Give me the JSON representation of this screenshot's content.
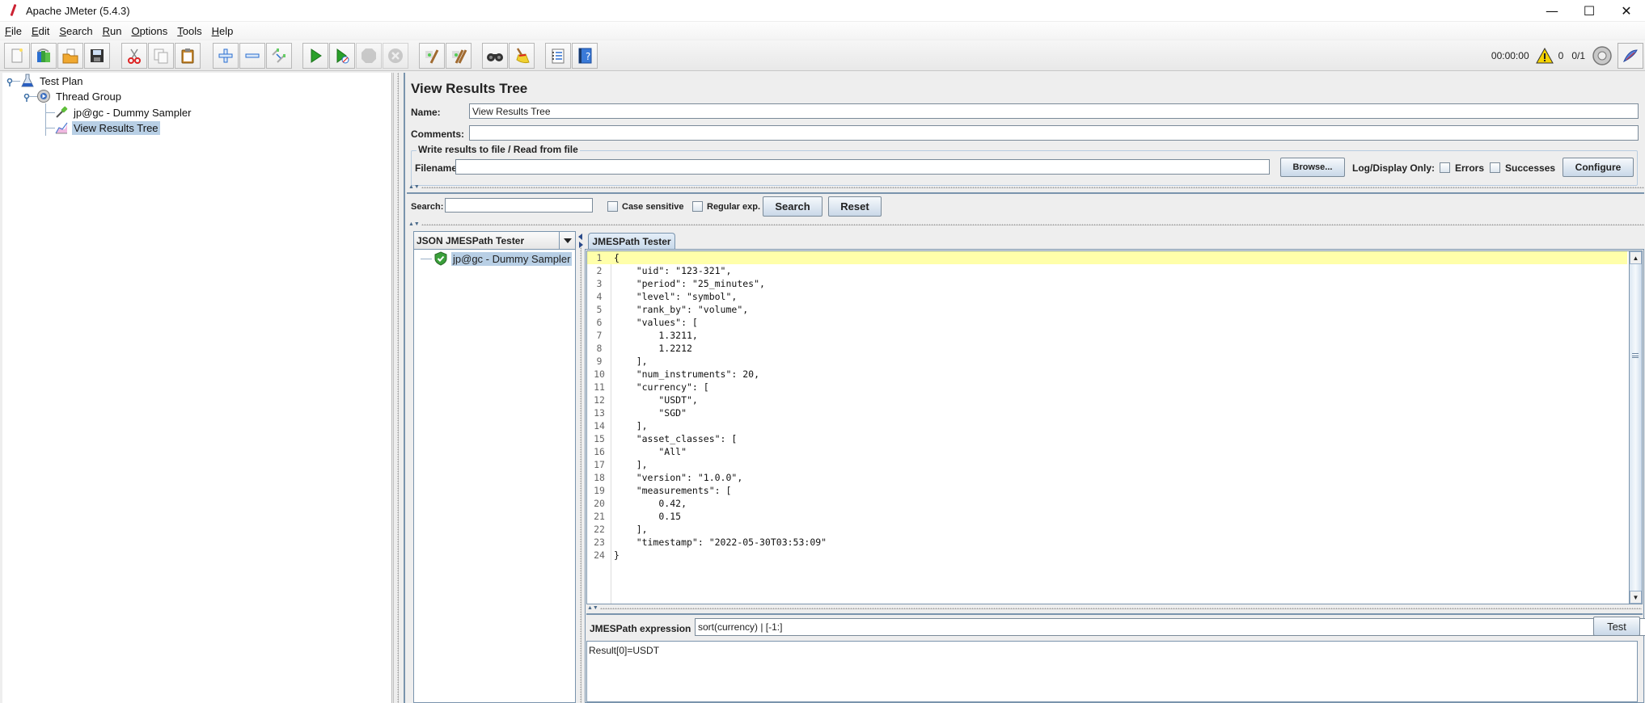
{
  "window": {
    "title": "Apache JMeter (5.4.3)",
    "controls": {
      "minimize": "—",
      "maximize": "☐",
      "close": "✕"
    }
  },
  "menu": [
    {
      "label": "File",
      "mnemonic": "F",
      "rest": "ile"
    },
    {
      "label": "Edit",
      "mnemonic": "E",
      "rest": "dit"
    },
    {
      "label": "Search",
      "mnemonic": "S",
      "rest": "earch"
    },
    {
      "label": "Run",
      "mnemonic": "R",
      "rest": "un"
    },
    {
      "label": "Options",
      "mnemonic": "O",
      "rest": "ptions"
    },
    {
      "label": "Tools",
      "mnemonic": "T",
      "rest": "ools"
    },
    {
      "label": "Help",
      "mnemonic": "H",
      "rest": "elp"
    }
  ],
  "toolbar": {
    "buttons": [
      {
        "name": "new-icon",
        "enabled": true
      },
      {
        "name": "templates-icon",
        "enabled": true
      },
      {
        "name": "open-icon",
        "enabled": true
      },
      {
        "name": "save-icon",
        "enabled": true
      },
      {
        "name": "cut-icon",
        "enabled": true
      },
      {
        "name": "copy-icon",
        "enabled": true
      },
      {
        "name": "paste-icon",
        "enabled": true
      },
      {
        "name": "expand-icon",
        "enabled": true
      },
      {
        "name": "collapse-icon",
        "enabled": true
      },
      {
        "name": "toggle-icon",
        "enabled": true
      },
      {
        "name": "start-icon",
        "enabled": true
      },
      {
        "name": "start-no-pauses-icon",
        "enabled": true
      },
      {
        "name": "stop-icon",
        "enabled": false
      },
      {
        "name": "shutdown-icon",
        "enabled": false
      },
      {
        "name": "clear-icon",
        "enabled": true
      },
      {
        "name": "clear-all-icon",
        "enabled": true
      },
      {
        "name": "search-icon",
        "enabled": true
      },
      {
        "name": "reset-search-icon",
        "enabled": true
      },
      {
        "name": "function-helper-icon",
        "enabled": true
      },
      {
        "name": "help-icon",
        "enabled": true
      }
    ]
  },
  "status": {
    "timer": "00:00:00",
    "warnings": "0",
    "threads": "0/1"
  },
  "tree": {
    "items": [
      {
        "label": "Test Plan",
        "icon": "test-plan-icon",
        "level": 0
      },
      {
        "label": "Thread Group",
        "icon": "thread-group-icon",
        "level": 1
      },
      {
        "label": "jp@gc - Dummy Sampler",
        "icon": "sampler-icon",
        "level": 2
      },
      {
        "label": "View Results Tree",
        "icon": "listener-icon",
        "level": 2,
        "selected": true
      }
    ]
  },
  "panel": {
    "title": "View Results Tree",
    "name_label": "Name:",
    "name_value": "View Results Tree",
    "comments_label": "Comments:",
    "comments_value": "",
    "file_group_title": "Write results to file / Read from file",
    "filename_label": "Filename",
    "filename_value": "",
    "browse_label": "Browse...",
    "log_display_label": "Log/Display Only:",
    "errors_label": "Errors",
    "errors_checked": false,
    "successes_label": "Successes",
    "successes_checked": false,
    "configure_label": "Configure"
  },
  "search": {
    "label": "Search:",
    "value": "",
    "case_sensitive_label": "Case sensitive",
    "case_sensitive_checked": false,
    "regex_label": "Regular exp.",
    "regex_checked": false,
    "search_button": "Search",
    "reset_button": "Reset"
  },
  "renderer": {
    "selected": "JSON JMESPath Tester",
    "results": [
      {
        "label": "jp@gc - Dummy Sampler",
        "status": "success"
      }
    ]
  },
  "tester": {
    "tab_label": "JMESPath Tester",
    "code_lines": [
      "{",
      "    \"uid\": \"123-321\",",
      "    \"period\": \"25_minutes\",",
      "    \"level\": \"symbol\",",
      "    \"rank_by\": \"volume\",",
      "    \"values\": [",
      "        1.3211,",
      "        1.2212",
      "    ],",
      "    \"num_instruments\": 20,",
      "    \"currency\": [",
      "        \"USDT\",",
      "        \"SGD\"",
      "    ],",
      "    \"asset_classes\": [",
      "        \"All\"",
      "    ],",
      "    \"version\": \"1.0.0\",",
      "    \"measurements\": [",
      "        0.42,",
      "        0.15",
      "    ],",
      "    \"timestamp\": \"2022-05-30T03:53:09\"",
      "}"
    ],
    "expression_label": "JMESPath expression",
    "expression_value": "sort(currency) | [-1:]",
    "test_button": "Test",
    "result": "Result[0]=USDT"
  },
  "colors": {
    "selection": "#b8cfe5",
    "current_line": "#ffffaa",
    "border_accent": "#7a94ad"
  }
}
